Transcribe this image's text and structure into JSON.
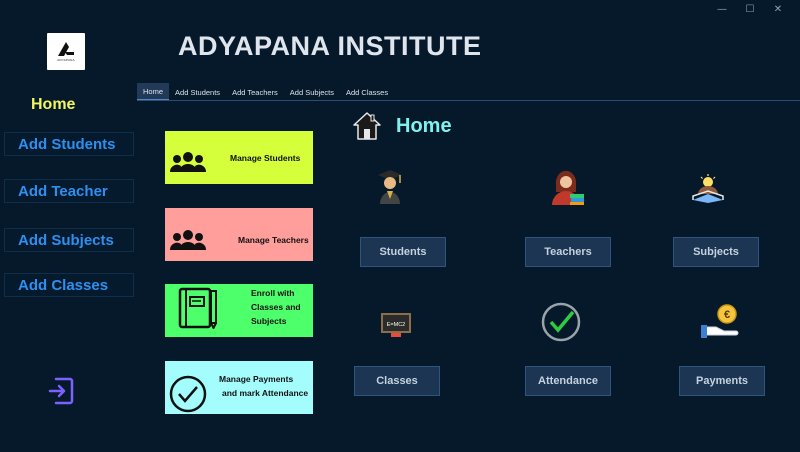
{
  "window": {
    "minimize": "—",
    "maximize": "☐",
    "close": "✕"
  },
  "logo": {
    "caption": "ADYAPANA"
  },
  "app": {
    "title": "ADYAPANA INSTITUTE"
  },
  "sidebar": {
    "home": "Home",
    "items": [
      {
        "label": "Add Students"
      },
      {
        "label": "Add Teacher"
      },
      {
        "label": "Add Subjects"
      },
      {
        "label": "Add Classes"
      }
    ]
  },
  "tabs": [
    {
      "label": "Home",
      "active": true
    },
    {
      "label": "Add Students"
    },
    {
      "label": "Add Teachers"
    },
    {
      "label": "Add Subjects"
    },
    {
      "label": "Add Classes"
    }
  ],
  "page": {
    "heading": "Home"
  },
  "cards": [
    {
      "label": "Manage Students",
      "color": "#d5ff3a",
      "icon": "group-icon"
    },
    {
      "label": "Manage Teachers",
      "color": "#ff9e9b",
      "icon": "group-icon"
    },
    {
      "label_lines": [
        "Enroll with",
        "Classes and",
        "Subjects"
      ],
      "color": "#4dff6b",
      "icon": "notebook-icon"
    },
    {
      "label_lines": [
        "Manage Payments",
        "and mark Attendance"
      ],
      "color": "#a4fdfd",
      "icon": "checkmark-circle-icon"
    }
  ],
  "dashboard": [
    {
      "label": "Students",
      "icon": "graduate-icon"
    },
    {
      "label": "Teachers",
      "icon": "teacher-icon"
    },
    {
      "label": "Subjects",
      "icon": "reading-icon"
    },
    {
      "label": "Classes",
      "icon": "blackboard-icon",
      "icon_text": "E=MC2"
    },
    {
      "label": "Attendance",
      "icon": "check-circle-icon"
    },
    {
      "label": "Payments",
      "icon": "euro-payment-icon"
    }
  ],
  "colors": {
    "background": "#06192b",
    "sidebar_text": "#2e8ff0",
    "home_highlight": "#f1f55e",
    "heading": "#7ff2ee",
    "logout_icon": "#7b61ff"
  }
}
